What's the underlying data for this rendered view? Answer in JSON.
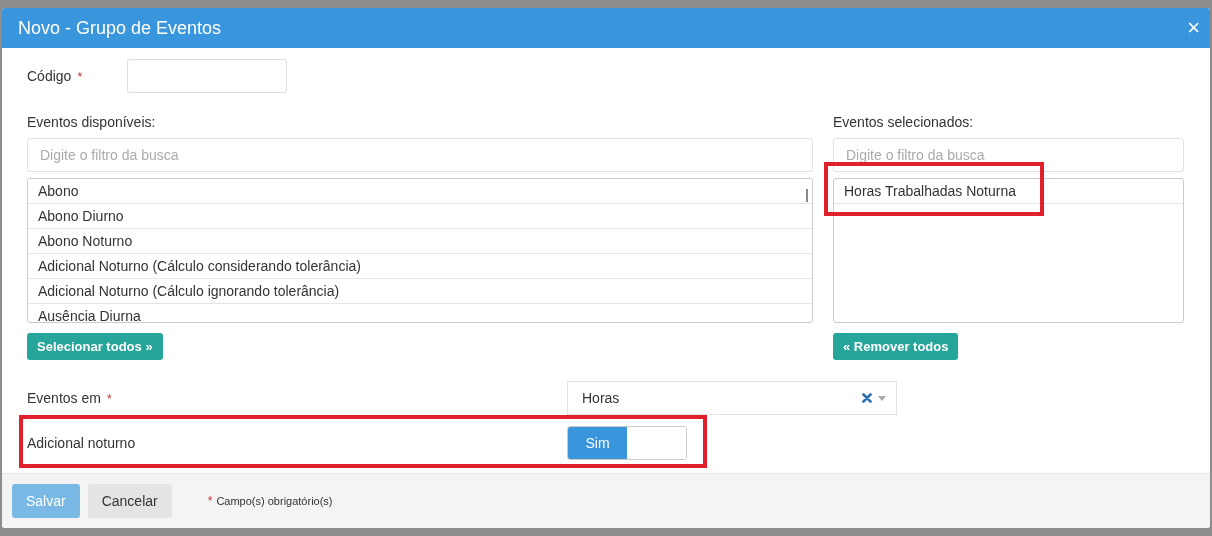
{
  "dialog": {
    "title": "Novo - Grupo de Eventos",
    "close": "×"
  },
  "code_field": {
    "label": "Código",
    "required": "*"
  },
  "available": {
    "label": "Eventos disponíveis:",
    "filter_placeholder": "Digite o filtro da busca",
    "items": [
      {
        "text": "Abono",
        "highlighted": false
      },
      {
        "text": "Abono Diurno",
        "highlighted": false
      },
      {
        "text": "Abono Noturno",
        "highlighted": false
      },
      {
        "text": "Adicional Noturno (Cálculo considerando tolerância)",
        "highlighted": false
      },
      {
        "text": "Adicional Noturno (Cálculo ignorando tolerância)",
        "highlighted": false
      },
      {
        "text": "Ausência Diurna",
        "highlighted": false
      }
    ],
    "button": "Selecionar todos",
    "button_icon": "»"
  },
  "selected": {
    "label": "Eventos selecionados:",
    "filter_placeholder": "Digite o filtro da busca",
    "items": [
      {
        "text": "Horas Trabalhadas Noturna",
        "highlighted": true
      }
    ],
    "button": "Remover todos",
    "button_icon": "«"
  },
  "events_in": {
    "label": "Eventos em",
    "required": "*",
    "value": "Horas"
  },
  "night_bonus": {
    "label": "Adicional noturno",
    "on": true,
    "on_label": "Sim",
    "highlighted": true
  },
  "footer": {
    "save": {
      "label": "Salvar",
      "disabled": true
    },
    "cancel": {
      "label": "Cancelar"
    },
    "note_mark": "*",
    "note": "Campo(s) obrigatório(s)"
  }
}
